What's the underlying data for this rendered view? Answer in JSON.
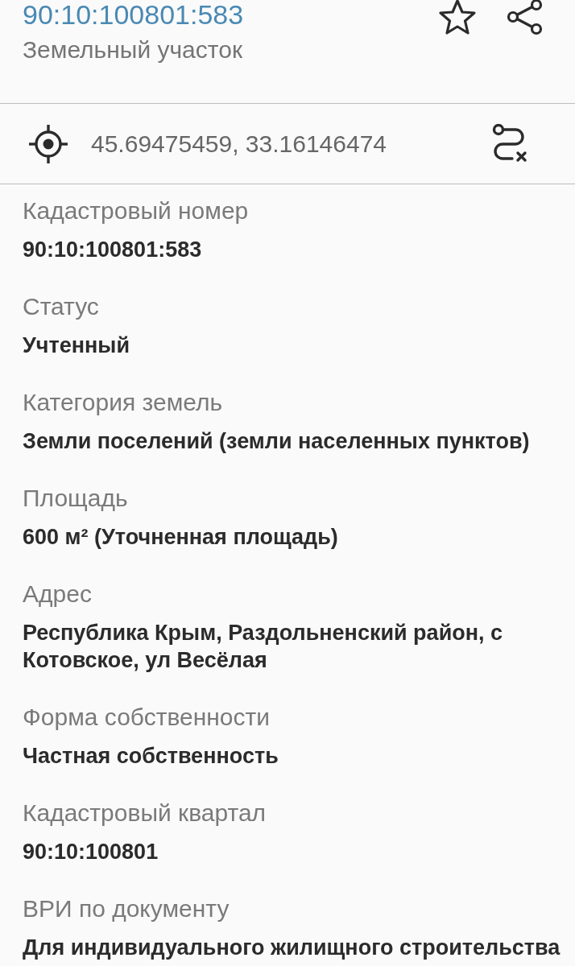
{
  "header": {
    "title": "90:10:100801:583",
    "subtitle": "Земельный участок"
  },
  "location": {
    "coordinates": "45.69475459, 33.16146474"
  },
  "fields": [
    {
      "label": "Кадастровый номер",
      "value": "90:10:100801:583"
    },
    {
      "label": "Статус",
      "value": "Учтенный"
    },
    {
      "label": "Категория земель",
      "value": "Земли поселений (земли населенных пунктов)"
    },
    {
      "label": "Площадь",
      "value": "600 м² (Уточненная площадь)"
    },
    {
      "label": "Адрес",
      "value": "Республика Крым, Раздольненский район, с Котовское, ул Весёлая"
    },
    {
      "label": "Форма собственности",
      "value": "Частная собственность"
    },
    {
      "label": "Кадастровый квартал",
      "value": "90:10:100801"
    },
    {
      "label": "ВРИ по документу",
      "value": "Для индивидуального жилищного строительства"
    }
  ]
}
